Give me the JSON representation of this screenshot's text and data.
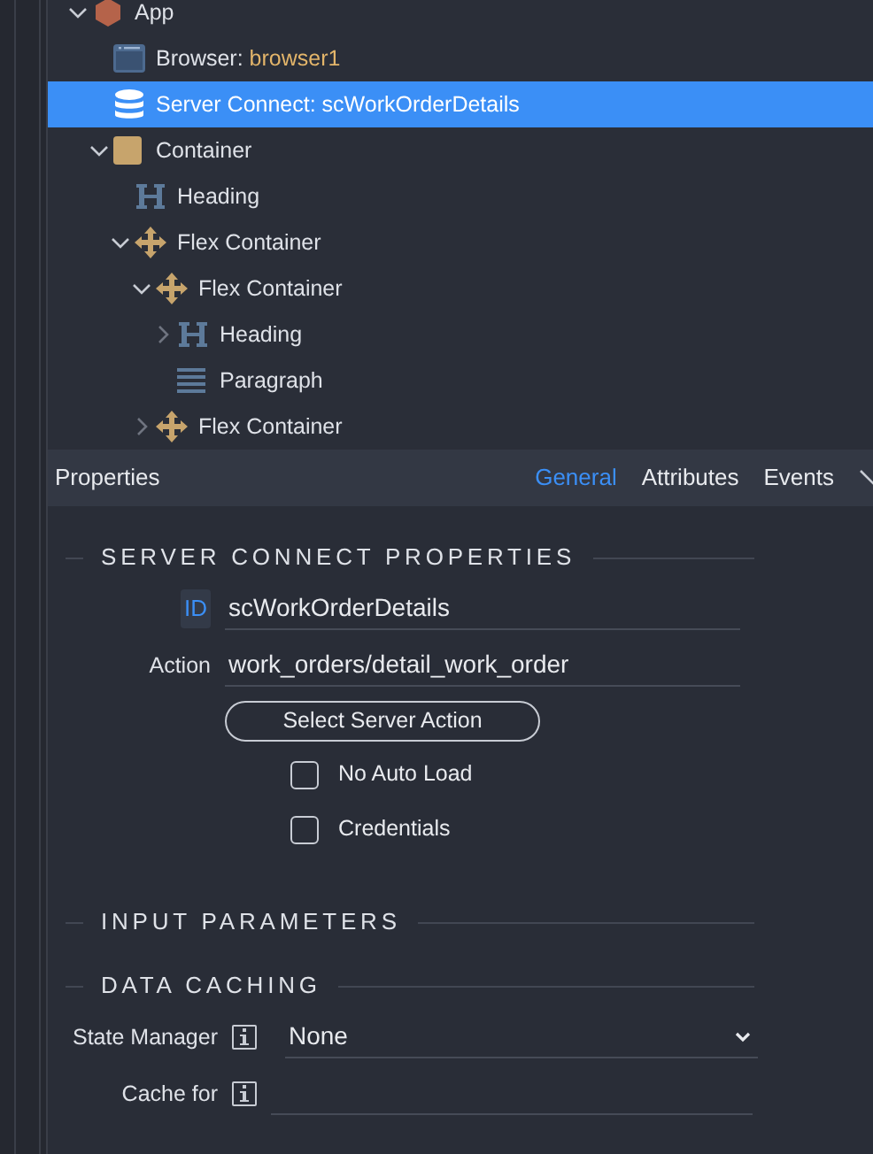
{
  "tree": [
    {
      "kind": "app",
      "label": "App",
      "expanded": true,
      "selected": false,
      "children": [
        {
          "kind": "browser",
          "label": "Browser:",
          "value": "browser1",
          "selected": false
        },
        {
          "kind": "server",
          "label": "Server Connect:",
          "value": "scWorkOrderDetails",
          "selected": true
        },
        {
          "kind": "container",
          "label": "Container",
          "expanded": true,
          "selected": false,
          "children": [
            {
              "kind": "heading",
              "label": "Heading",
              "selected": false
            },
            {
              "kind": "flex",
              "label": "Flex Container",
              "expanded": true,
              "selected": false,
              "children": [
                {
                  "kind": "flex",
                  "label": "Flex Container",
                  "expanded": true,
                  "selected": false,
                  "children": [
                    {
                      "kind": "heading",
                      "label": "Heading",
                      "expanded": false,
                      "selected": false
                    },
                    {
                      "kind": "paragraph",
                      "label": "Paragraph",
                      "selected": false
                    }
                  ]
                },
                {
                  "kind": "flex",
                  "label": "Flex Container",
                  "expanded": false,
                  "selected": false
                }
              ]
            }
          ]
        }
      ]
    }
  ],
  "properties": {
    "title": "Properties",
    "tabs": [
      {
        "label": "General",
        "selected": true
      },
      {
        "label": "Attributes",
        "selected": false
      },
      {
        "label": "Events",
        "selected": false
      }
    ],
    "sections": [
      {
        "title": "SERVER CONNECT PROPERTIES",
        "fields": [
          {
            "kind": "id",
            "label": "ID",
            "value": "scWorkOrderDetails"
          },
          {
            "kind": "text",
            "label": "Action",
            "value": "work_orders/detail_work_order"
          },
          {
            "kind": "button",
            "label": "Select Server Action"
          },
          {
            "kind": "checkbox",
            "label": "No Auto Load",
            "checked": false
          },
          {
            "kind": "checkbox",
            "label": "Credentials",
            "checked": false
          }
        ]
      },
      {
        "title": "INPUT PARAMETERS"
      },
      {
        "title": "DATA CACHING",
        "fields": [
          {
            "kind": "select",
            "label": "State Manager",
            "info": true,
            "value": "None"
          },
          {
            "kind": "text",
            "label": "Cache for",
            "info": true
          }
        ]
      }
    ]
  }
}
